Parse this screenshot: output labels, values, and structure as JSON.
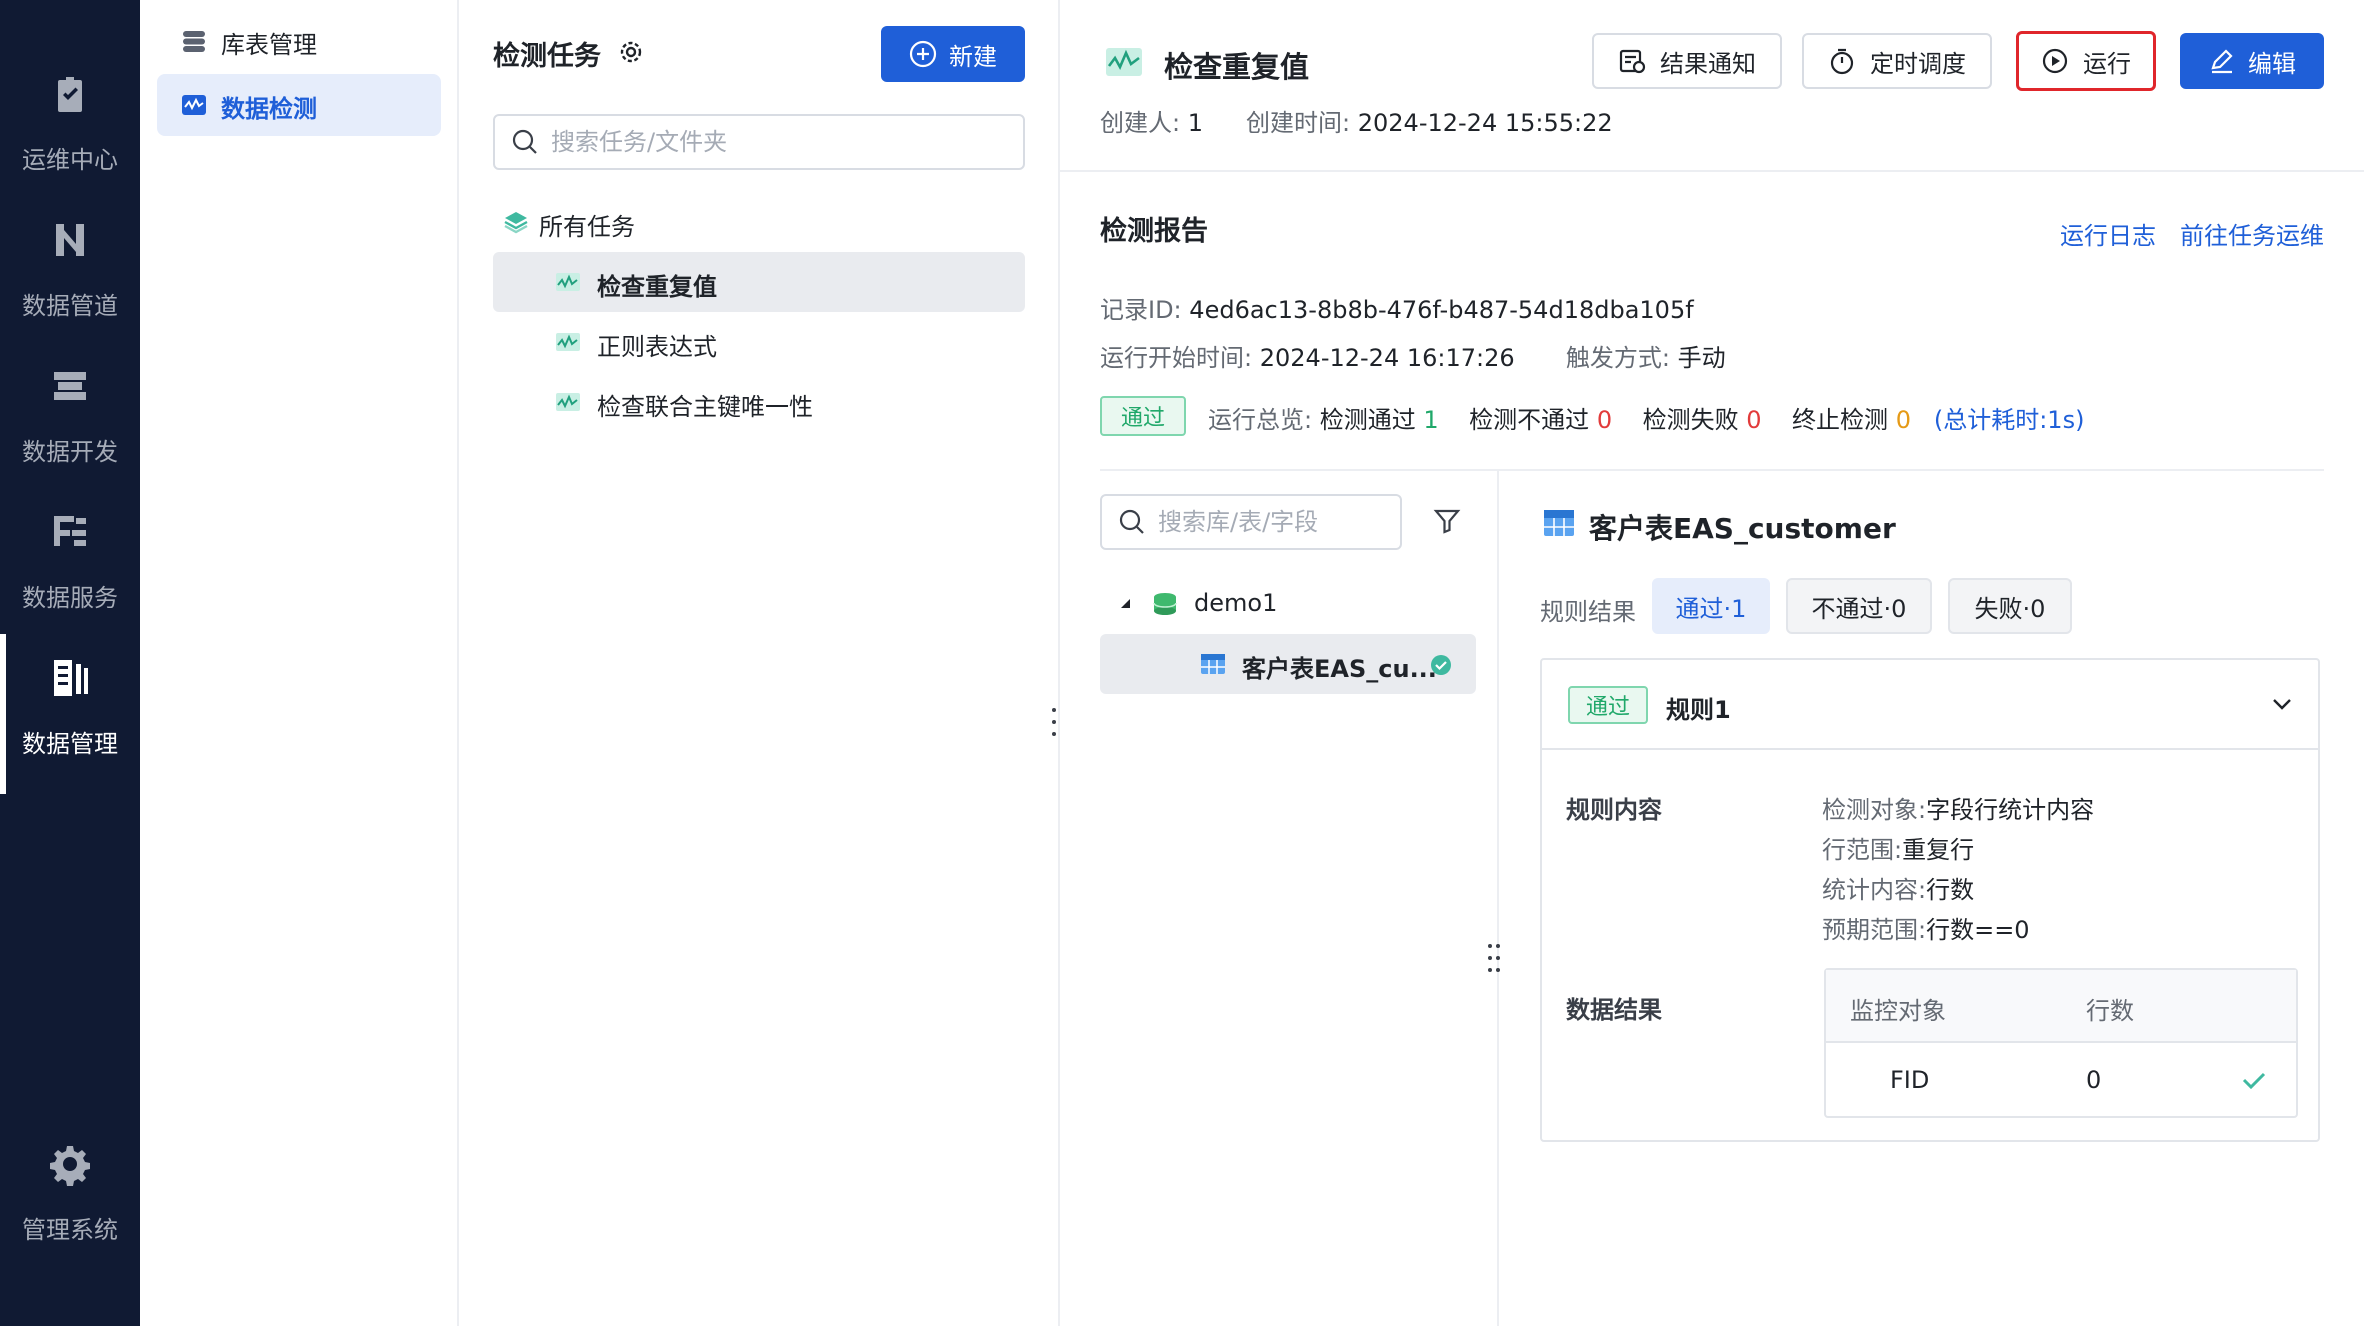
{
  "rail": {
    "items": [
      {
        "label": "运维中心",
        "icon": "clipboard-check-icon"
      },
      {
        "label": "数据管道",
        "icon": "pipeline-icon"
      },
      {
        "label": "数据开发",
        "icon": "server-stack-icon"
      },
      {
        "label": "数据服务",
        "icon": "service-icon"
      },
      {
        "label": "数据管理",
        "icon": "data-management-icon",
        "active": true
      },
      {
        "label": "管理系统",
        "icon": "gear-icon"
      }
    ]
  },
  "subnav": {
    "items": [
      {
        "label": "库表管理",
        "icon": "database-icon"
      },
      {
        "label": "数据检测",
        "icon": "monitor-wave-icon",
        "active": true
      }
    ]
  },
  "tasks": {
    "title": "检测任务",
    "new_label": "新建",
    "search_placeholder": "搜索任务/文件夹",
    "root_label": "所有任务",
    "items": [
      {
        "label": "检查重复值",
        "selected": true
      },
      {
        "label": "正则表达式"
      },
      {
        "label": "检查联合主键唯一性"
      }
    ]
  },
  "header": {
    "title": "检查重复值",
    "creator_label": "创建人:",
    "creator": "1",
    "created_label": "创建时间:",
    "created_at": "2024-12-24 15:55:22",
    "buttons": {
      "notify": "结果通知",
      "schedule": "定时调度",
      "run": "运行",
      "edit": "编辑"
    }
  },
  "report": {
    "title": "检测报告",
    "run_log": "运行日志",
    "goto_ops": "前往任务运维",
    "record_label": "记录ID:",
    "record_id": "4ed6ac13-8b8b-476f-b487-54d18dba105f",
    "start_label": "运行开始时间:",
    "start_time": "2024-12-24 16:17:26",
    "trigger_label": "触发方式:",
    "trigger": "手动",
    "status": "通过",
    "overview_label": "运行总览:",
    "passed_label": "检测通过",
    "passed": "1",
    "failed_label": "检测不通过",
    "failed": "0",
    "error_label": "检测失败",
    "error": "0",
    "stopped_label": "终止检测",
    "stopped": "0",
    "total_time": "(总计耗时:1s)"
  },
  "object_tree": {
    "search_placeholder": "搜索库/表/字段",
    "db": "demo1",
    "table": "客户表EAS_cu..."
  },
  "result": {
    "table_title": "客户表EAS_customer",
    "rule_result_label": "规则结果",
    "chips": [
      "通过·1",
      "不通过·0",
      "失败·0"
    ],
    "rule": {
      "status": "通过",
      "name": "规则1",
      "content_label": "规则内容",
      "lines": [
        {
          "k": "检测对象:",
          "v": "字段行统计内容"
        },
        {
          "k": "行范围:",
          "v": "重复行"
        },
        {
          "k": "统计内容:",
          "v": "行数"
        },
        {
          "k": "预期范围:",
          "v": "行数==0"
        }
      ],
      "data_result_label": "数据结果",
      "columns": [
        "监控对象",
        "行数"
      ],
      "rows": [
        {
          "object": "FID",
          "count": "0"
        }
      ]
    }
  },
  "colors": {
    "primary": "#1f5fd8",
    "success": "#20a86a",
    "danger": "#e23b3b",
    "warning": "#e59a17",
    "rail_bg": "#101a33",
    "highlight": "#e0262b"
  }
}
